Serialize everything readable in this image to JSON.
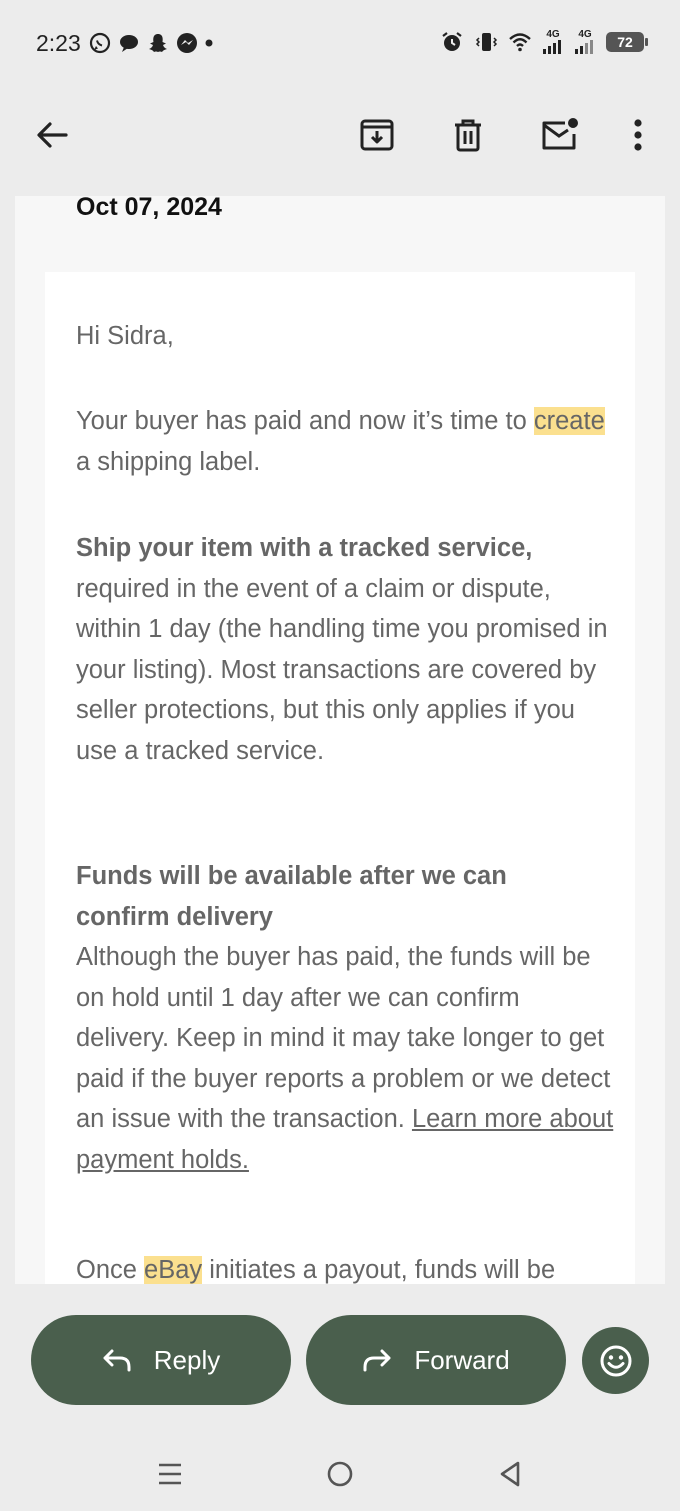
{
  "status_bar": {
    "time": "2:23",
    "network_1": "4G",
    "network_2": "4G",
    "battery": "72",
    "left_icons": [
      "whatsapp-icon",
      "chat-icon",
      "snapchat-icon",
      "messenger-icon",
      "dot-icon"
    ],
    "right_icons": [
      "alarm-icon",
      "vibrate-icon",
      "wifi-icon",
      "signal-icon",
      "signal-icon",
      "battery-icon"
    ]
  },
  "toolbar": {
    "icons": [
      "back-arrow-icon",
      "archive-icon",
      "delete-icon",
      "mark-unread-icon",
      "more-vert-icon"
    ]
  },
  "email": {
    "date": "Oct 07, 2024",
    "greeting": "Hi Sidra,",
    "para1_before": "Your buyer has paid and now it’s time to ",
    "para1_highlight": "create",
    "para1_after": " a shipping label.",
    "para2_bold": "Ship your item with a tracked service,",
    "para2_text": " required in the event of a claim or dispute, within 1 day (the handling time you promised in your listing). Most transactions are covered by seller protections, but this only applies if you use a tracked service.",
    "para3_bold": "Funds will be available after we can confirm delivery",
    "para3_text": "Although the buyer has paid, the funds will be on hold until 1 day after we can confirm delivery. Keep in mind it may take longer to get paid if the buyer reports a problem or we detect an issue with the transaction. ",
    "para3_link": "Learn more about payment holds.",
    "para4_before": "Once ",
    "para4_highlight": "eBay",
    "para4_after": " initiates a payout, funds will be"
  },
  "actions": {
    "reply_label": "Reply",
    "forward_label": "Forward"
  },
  "colors": {
    "accent": "#4a5f4d",
    "highlight": "#fbe08f",
    "background": "#ececec",
    "body_text": "#666666"
  }
}
